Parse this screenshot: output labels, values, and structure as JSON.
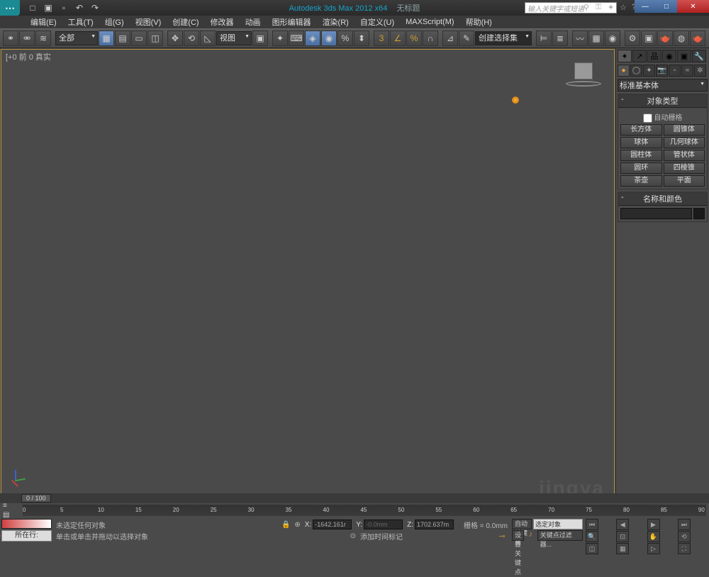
{
  "title": {
    "app": "Autodesk 3ds Max  2012  x64",
    "doc": "无标题",
    "search_placeholder": "输入关键字或短语"
  },
  "menus": [
    "编辑(E)",
    "工具(T)",
    "组(G)",
    "视图(V)",
    "创建(C)",
    "修改器",
    "动画",
    "图形编辑器",
    "渲染(R)",
    "自定义(U)",
    "MAXScript(M)",
    "帮助(H)"
  ],
  "toolbar": {
    "filter_dropdown": "全部",
    "view_dropdown": "视图",
    "selection_set": "创建选择集"
  },
  "viewport": {
    "label": "[+0 前 0 真实"
  },
  "command_panel": {
    "category_dropdown": "标准基本体",
    "rollout_obj": "对象类型",
    "auto_grid": "自动栅格",
    "objects": [
      "长方体",
      "圆锥体",
      "球体",
      "几何球体",
      "圆柱体",
      "管状体",
      "圆环",
      "四棱锥",
      "茶壶",
      "平面"
    ],
    "rollout_name": "名称和颜色"
  },
  "timeline": {
    "slider_label": "0 / 100",
    "ticks": [
      "0",
      "5",
      "10",
      "15",
      "20",
      "25",
      "30",
      "35",
      "40",
      "45",
      "50",
      "55",
      "60",
      "65",
      "70",
      "75",
      "80",
      "85",
      "90"
    ]
  },
  "status": {
    "cur_line_label": "所在行:",
    "no_selection": "未选定任何对象",
    "hint": "单击或单击并拖动以选择对象",
    "add_tag": "添加时间标记",
    "x": "-1642.161r",
    "y": "-0.0mm",
    "z": "1702.637m",
    "grid": "栅格 = 0.0mm",
    "auto_key": "自动关键点",
    "set_key": "设置关键点",
    "sel_obj": "选定对象",
    "key_filter": "关键点过滤器..."
  },
  "watermark": "jingya"
}
